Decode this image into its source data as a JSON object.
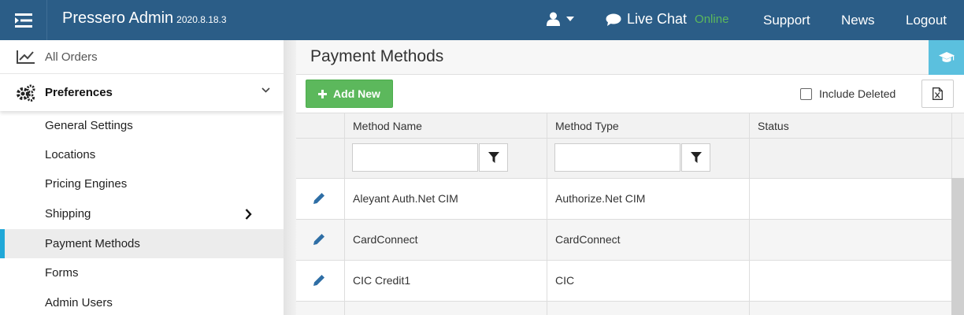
{
  "app": {
    "name": "Pressero Admin",
    "version": "2020.8.18.3"
  },
  "topnav": {
    "live_chat": "Live Chat",
    "chat_status": "Online",
    "support": "Support",
    "news": "News",
    "logout": "Logout"
  },
  "sidebar": {
    "all_orders": "All Orders",
    "preferences": "Preferences",
    "items": [
      {
        "label": "General Settings"
      },
      {
        "label": "Locations"
      },
      {
        "label": "Pricing Engines"
      },
      {
        "label": "Shipping"
      },
      {
        "label": "Payment Methods"
      },
      {
        "label": "Forms"
      },
      {
        "label": "Admin Users"
      }
    ]
  },
  "page": {
    "title": "Payment Methods",
    "add_new": "Add New",
    "include_deleted": "Include Deleted"
  },
  "table": {
    "columns": [
      "Method Name",
      "Method Type",
      "Status"
    ],
    "rows": [
      {
        "method_name": "Aleyant Auth.Net CIM",
        "method_type": "Authorize.Net CIM",
        "status": ""
      },
      {
        "method_name": "CardConnect",
        "method_type": "CardConnect",
        "status": ""
      },
      {
        "method_name": "CIC Credit1",
        "method_type": "CIC",
        "status": ""
      }
    ]
  },
  "colors": {
    "topbar": "#2b5d87",
    "accent": "#20a8d8",
    "add_button": "#5cb85c",
    "online": "#5cb85c",
    "help_button": "#5bc0de",
    "edit_icon": "#2e6ea5"
  },
  "icons": {
    "menu_toggle": "menu-toggle-icon",
    "user": "user-icon",
    "chat": "chat-bubble-icon",
    "all_orders": "line-chart-icon",
    "preferences": "gears-icon",
    "help": "graduation-cap-icon",
    "add": "plus-icon",
    "export": "excel-export-icon",
    "filter": "filter-icon",
    "edit": "pencil-icon"
  }
}
